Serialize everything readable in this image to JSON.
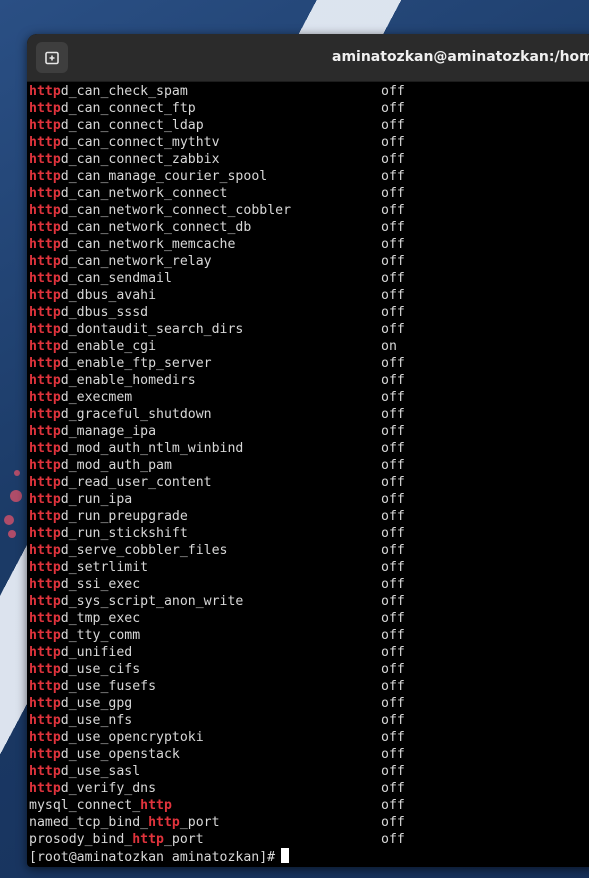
{
  "window": {
    "title": "aminatozkan@aminatozkan:/home/aminatozkan"
  },
  "highlight": "http",
  "rows": [
    {
      "pre": "",
      "mid": "d_can_check_spam",
      "post": "",
      "value": "off"
    },
    {
      "pre": "",
      "mid": "d_can_connect_ftp",
      "post": "",
      "value": "off"
    },
    {
      "pre": "",
      "mid": "d_can_connect_ldap",
      "post": "",
      "value": "off"
    },
    {
      "pre": "",
      "mid": "d_can_connect_mythtv",
      "post": "",
      "value": "off"
    },
    {
      "pre": "",
      "mid": "d_can_connect_zabbix",
      "post": "",
      "value": "off"
    },
    {
      "pre": "",
      "mid": "d_can_manage_courier_spool",
      "post": "",
      "value": "off"
    },
    {
      "pre": "",
      "mid": "d_can_network_connect",
      "post": "",
      "value": "off"
    },
    {
      "pre": "",
      "mid": "d_can_network_connect_cobbler",
      "post": "",
      "value": "off"
    },
    {
      "pre": "",
      "mid": "d_can_network_connect_db",
      "post": "",
      "value": "off"
    },
    {
      "pre": "",
      "mid": "d_can_network_memcache",
      "post": "",
      "value": "off"
    },
    {
      "pre": "",
      "mid": "d_can_network_relay",
      "post": "",
      "value": "off"
    },
    {
      "pre": "",
      "mid": "d_can_sendmail",
      "post": "",
      "value": "off"
    },
    {
      "pre": "",
      "mid": "d_dbus_avahi",
      "post": "",
      "value": "off"
    },
    {
      "pre": "",
      "mid": "d_dbus_sssd",
      "post": "",
      "value": "off"
    },
    {
      "pre": "",
      "mid": "d_dontaudit_search_dirs",
      "post": "",
      "value": "off"
    },
    {
      "pre": "",
      "mid": "d_enable_cgi",
      "post": "",
      "value": "on"
    },
    {
      "pre": "",
      "mid": "d_enable_ftp_server",
      "post": "",
      "value": "off"
    },
    {
      "pre": "",
      "mid": "d_enable_homedirs",
      "post": "",
      "value": "off"
    },
    {
      "pre": "",
      "mid": "d_execmem",
      "post": "",
      "value": "off"
    },
    {
      "pre": "",
      "mid": "d_graceful_shutdown",
      "post": "",
      "value": "off"
    },
    {
      "pre": "",
      "mid": "d_manage_ipa",
      "post": "",
      "value": "off"
    },
    {
      "pre": "",
      "mid": "d_mod_auth_ntlm_winbind",
      "post": "",
      "value": "off"
    },
    {
      "pre": "",
      "mid": "d_mod_auth_pam",
      "post": "",
      "value": "off"
    },
    {
      "pre": "",
      "mid": "d_read_user_content",
      "post": "",
      "value": "off"
    },
    {
      "pre": "",
      "mid": "d_run_ipa",
      "post": "",
      "value": "off"
    },
    {
      "pre": "",
      "mid": "d_run_preupgrade",
      "post": "",
      "value": "off"
    },
    {
      "pre": "",
      "mid": "d_run_stickshift",
      "post": "",
      "value": "off"
    },
    {
      "pre": "",
      "mid": "d_serve_cobbler_files",
      "post": "",
      "value": "off"
    },
    {
      "pre": "",
      "mid": "d_setrlimit",
      "post": "",
      "value": "off"
    },
    {
      "pre": "",
      "mid": "d_ssi_exec",
      "post": "",
      "value": "off"
    },
    {
      "pre": "",
      "mid": "d_sys_script_anon_write",
      "post": "",
      "value": "off"
    },
    {
      "pre": "",
      "mid": "d_tmp_exec",
      "post": "",
      "value": "off"
    },
    {
      "pre": "",
      "mid": "d_tty_comm",
      "post": "",
      "value": "off"
    },
    {
      "pre": "",
      "mid": "d_unified",
      "post": "",
      "value": "off"
    },
    {
      "pre": "",
      "mid": "d_use_cifs",
      "post": "",
      "value": "off"
    },
    {
      "pre": "",
      "mid": "d_use_fusefs",
      "post": "",
      "value": "off"
    },
    {
      "pre": "",
      "mid": "d_use_gpg",
      "post": "",
      "value": "off"
    },
    {
      "pre": "",
      "mid": "d_use_nfs",
      "post": "",
      "value": "off"
    },
    {
      "pre": "",
      "mid": "d_use_opencryptoki",
      "post": "",
      "value": "off"
    },
    {
      "pre": "",
      "mid": "d_use_openstack",
      "post": "",
      "value": "off"
    },
    {
      "pre": "",
      "mid": "d_use_sasl",
      "post": "",
      "value": "off"
    },
    {
      "pre": "",
      "mid": "d_verify_dns",
      "post": "",
      "value": "off"
    },
    {
      "pre": "mysql_connect_",
      "mid": "",
      "post": "",
      "value": "off"
    },
    {
      "pre": "named_tcp_bind_",
      "mid": "_port",
      "post": "",
      "value": "off"
    },
    {
      "pre": "prosody_bind_",
      "mid": "_port",
      "post": "",
      "value": "off"
    }
  ],
  "prompt": "[root@aminatozkan aminatozkan]#",
  "colors": {
    "highlight": "#e0333c",
    "text": "#d8d8d8",
    "background": "#000000"
  },
  "icons": {
    "new_tab": "new-tab-icon"
  }
}
